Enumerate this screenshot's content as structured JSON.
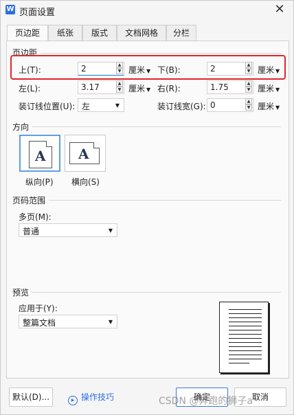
{
  "window": {
    "title": "页面设置",
    "app_icon_letter": "W",
    "close_glyph": "✕"
  },
  "tabs": [
    {
      "label": "页边距",
      "active": true
    },
    {
      "label": "纸张"
    },
    {
      "label": "版式"
    },
    {
      "label": "文档网格"
    },
    {
      "label": "分栏"
    }
  ],
  "margins": {
    "group_title": "页边距",
    "top": {
      "label": "上(T):",
      "value": "2",
      "unit": "厘米"
    },
    "bottom": {
      "label": "下(B):",
      "value": "2",
      "unit": "厘米"
    },
    "left": {
      "label": "左(L):",
      "value": "3.17",
      "unit": "厘米"
    },
    "right": {
      "label": "右(R):",
      "value": "1.75",
      "unit": "厘米"
    },
    "gutter_position": {
      "label": "装订线位置(U):",
      "value": "左"
    },
    "gutter_width": {
      "label": "装订线宽(G):",
      "value": "0",
      "unit": "厘米"
    }
  },
  "orientation": {
    "group_title": "方向",
    "portrait_label": "纵向(P)",
    "landscape_label": "横向(S)",
    "glyph": "A",
    "selected": "portrait"
  },
  "page_range": {
    "group_title": "页码范围",
    "multi_label": "多页(M):",
    "multi_value": "普通"
  },
  "preview": {
    "group_title": "预览",
    "apply_label": "应用于(Y):",
    "apply_value": "整篇文档"
  },
  "footer": {
    "default_label": "默认(D)...",
    "tips_label": "操作技巧",
    "ok_label": "确定",
    "cancel_label": "取消"
  },
  "watermark": "CSDN @奔跑的狮子a",
  "colors": {
    "accent": "#2f6fe4",
    "highlight": "#e0262b",
    "focus": "#5aa0e6"
  }
}
